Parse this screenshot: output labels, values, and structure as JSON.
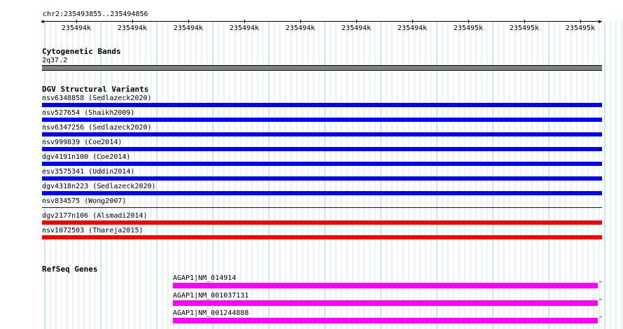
{
  "ruler": {
    "location": "chr2:235493855..235494856",
    "ticks": [
      "235494k",
      "235494k",
      "235494k",
      "235494k",
      "235494k",
      "235494k",
      "235494k",
      "235495k",
      "235495k",
      "235495k"
    ]
  },
  "cytoband": {
    "title": "Cytogenetic Bands",
    "band": "2q37.2",
    "color": "#808080"
  },
  "dgv": {
    "title": "DGV Structural Variants",
    "items": [
      {
        "label": "nsv6348858 (Sedlazeck2020)",
        "color": "#0000ff",
        "style": "thick"
      },
      {
        "label": "nsv527654 (Shaikh2009)",
        "color": "#0000ff",
        "style": "thick"
      },
      {
        "label": "nsv6347256 (Sedlazeck2020)",
        "color": "#0000ff",
        "style": "thick"
      },
      {
        "label": "nsv999839 (Coe2014)",
        "color": "#0000ff",
        "style": "thick"
      },
      {
        "label": "dgv4191n100 (Coe2014)",
        "color": "#0000ff",
        "style": "thick"
      },
      {
        "label": "esv3575341 (Uddin2014)",
        "color": "#0000ff",
        "style": "thick"
      },
      {
        "label": "dgv4318n223 (Sedlazeck2020)",
        "color": "#0000ff",
        "style": "thick"
      },
      {
        "label": "nsv834575 (Wong2007)",
        "color": "#0000ff",
        "style": "thin"
      },
      {
        "label": "dgv2177n106 (Alsmadi2014)",
        "color": "#ff0000",
        "style": "thick"
      },
      {
        "label": "nsv1072503 (Thareja2015)",
        "color": "#ff0000",
        "style": "thick"
      }
    ]
  },
  "refseq": {
    "title": "RefSeq Genes",
    "color": "#ff00ff",
    "end_glyph": "^",
    "genes": [
      {
        "label": "AGAP1|NM_014914"
      },
      {
        "label": "AGAP1|NM_001037131"
      },
      {
        "label": "AGAP1|NM_001244888"
      }
    ]
  }
}
